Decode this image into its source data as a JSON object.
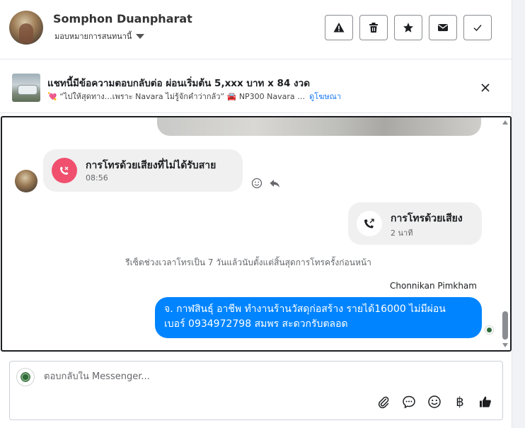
{
  "header": {
    "name": "Somphon Duanpharat",
    "assign_label": "มอบหมายการสนทนานี้",
    "actions": [
      "warning",
      "delete",
      "star",
      "mail",
      "done"
    ]
  },
  "ad": {
    "title": "แชทนี้มีข้อความตอบกลับต่อ ผ่อนเริ่มต้น 5,xxx บาท x 84 งวด",
    "subtitle": "💘 “ไปให้สุดทาง…เพราะ Navara ไม่รู้จักคำว่ากลัว” 🚘 NP300 Navara …",
    "link": "ดูโฆษณา"
  },
  "messages": {
    "missed_call": {
      "title": "การโทรด้วยเสียงที่ไม่ได้รับสาย",
      "time": "08:56"
    },
    "outgoing_call": {
      "title": "การโทรด้วยเสียง",
      "duration": "2 นาที"
    },
    "system_note": "รีเซ็ตช่วงเวลาโทรเป็น 7 วันแล้วนับตั้งแต่สิ้นสุดการโทรครั้งก่อนหน้า",
    "sender": "Chonnikan Pimkham",
    "text_line1": "จ. กาฬสินธุ์ อาชีพ ทำงานร้านวัสดุก่อสร้าง รายได้16000 ไม่มีผ่อน",
    "text_line2": "เบอร์ 0934972798 สมพร สะดวกรับตลอด"
  },
  "composer": {
    "placeholder": "ตอบกลับใน Messenger...",
    "currency_symbol": "฿"
  },
  "colors": {
    "accent": "#0084ff",
    "missed": "#f0506e",
    "link": "#1877f2"
  }
}
